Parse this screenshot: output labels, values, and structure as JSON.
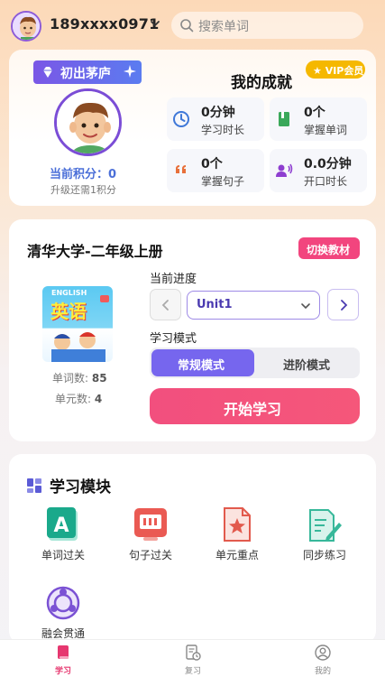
{
  "header": {
    "phone": "189xxxx0971",
    "search_placeholder": "搜索单词"
  },
  "profile": {
    "rank_badge": "初出茅庐",
    "score_text": "当前积分：0",
    "score_hint": "升级还需1积分"
  },
  "achievements": {
    "title": "我的成就",
    "vip_label": "★ VIP会员",
    "stats": [
      {
        "value": "0分钟",
        "label": "学习时长",
        "icon": "clock-icon",
        "color": "#3f78d8"
      },
      {
        "value": "0个",
        "label": "掌握单词",
        "icon": "book-icon",
        "color": "#3aa85a"
      },
      {
        "value": "0个",
        "label": "掌握句子",
        "icon": "quote-icon",
        "color": "#e8703a"
      },
      {
        "value": "0.0分钟",
        "label": "开口时长",
        "icon": "speaker-icon",
        "color": "#8e3ed0"
      }
    ]
  },
  "textbook": {
    "title": "清华大学-二年级上册",
    "switch_label": "切换教材",
    "cover_en": "ENGLISH",
    "cover_cn": "英语",
    "word_count_label": "单词数:",
    "word_count": "85",
    "unit_count_label": "单元数:",
    "unit_count": "4",
    "progress_label": "当前进度",
    "current_unit": "Unit1",
    "mode_label": "学习模式",
    "modes": [
      "常规模式",
      "进阶模式"
    ],
    "selected_mode": "常规模式",
    "start_label": "开始学习"
  },
  "modules": {
    "title": "学习模块",
    "items": [
      {
        "label": "单词过关",
        "icon": "word-a-icon",
        "color": "#1aa98b"
      },
      {
        "label": "句子过关",
        "icon": "sentence-board-icon",
        "color": "#ea5a53"
      },
      {
        "label": "单元重点",
        "icon": "star-document-icon",
        "color": "#e25a4d"
      },
      {
        "label": "同步练习",
        "icon": "edit-document-icon",
        "color": "#37b89a"
      },
      {
        "label": "融会贯通",
        "icon": "connect-circle-icon",
        "color": "#7b52d4"
      }
    ]
  },
  "tabbar": {
    "tabs": [
      {
        "label": "学习",
        "active": true
      },
      {
        "label": "复习",
        "active": false
      },
      {
        "label": "我的",
        "active": false
      }
    ],
    "accent": "#e6376f"
  }
}
